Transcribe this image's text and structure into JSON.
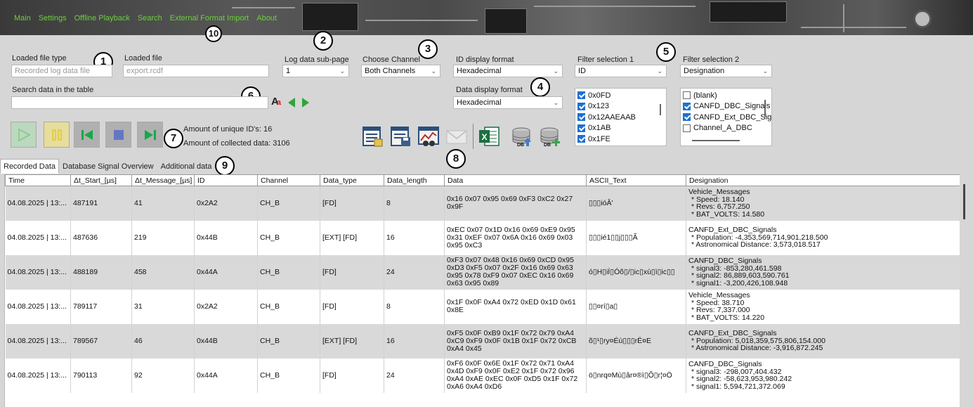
{
  "menu": [
    "Main",
    "Settings",
    "Offline Playback",
    "Search",
    "External Format Import",
    "About"
  ],
  "callouts": [
    "1",
    "2",
    "3",
    "4",
    "5",
    "6",
    "7",
    "8",
    "9",
    "10"
  ],
  "loaded_file_type": {
    "label": "Loaded file type",
    "placeholder": "Recorded log data file"
  },
  "loaded_file": {
    "label": "Loaded file",
    "placeholder": "export.rcdf"
  },
  "log_subpage": {
    "label": "Log data sub-page",
    "value": "1"
  },
  "channel": {
    "label": "Choose Channel",
    "value": "Both Channels"
  },
  "id_format": {
    "label": "ID display format",
    "value": "Hexadecimal"
  },
  "data_format": {
    "label": "Data display format",
    "value": "Hexadecimal"
  },
  "filter1": {
    "label": "Filter selection 1",
    "value": "ID",
    "items": [
      "0x0FD",
      "0x123",
      "0x12AAEAAB",
      "0x1AB",
      "0x1FE"
    ]
  },
  "filter2": {
    "label": "Filter selection 2",
    "value": "Designation",
    "items": [
      {
        "text": "(blank)",
        "checked": false
      },
      {
        "text": "CANFD_DBC_Signals",
        "checked": true
      },
      {
        "text": "CANFD_Ext_DBC_Sig",
        "checked": true
      },
      {
        "text": "Channel_A_DBC",
        "checked": false
      }
    ]
  },
  "search": {
    "label": "Search data in the table",
    "value": ""
  },
  "stats": {
    "unique_ids": "Amount of unique ID's: 16",
    "collected": "Amount of collected data: 3106"
  },
  "colors": {
    "menu": "#6ccf3c",
    "checkbox": "#1f6fd1",
    "row_alt": "#d9d9d9"
  },
  "tabs": [
    "Recorded Data",
    "Database Signal Overview",
    "Additional data"
  ],
  "table": {
    "columns": [
      "Time",
      "Δt_Start_[µs]",
      "Δt_Message_[µs]",
      "ID",
      "Channel",
      "Data_type",
      "Data_length",
      "Data",
      "ASCII_Text",
      "Designation"
    ],
    "rows": [
      {
        "time": "04.08.2025 | 13:...",
        "dt_start": "487191",
        "dt_msg": "41",
        "id": "0x2A2",
        "channel": "CH_B",
        "dtype": "[FD]",
        "dlen": "8",
        "data": "0x16 0x07 0x95 0x69 0xF3 0xC2 0x27 0x9F",
        "ascii": "▯▯▯ióÂ'",
        "desig": "Vehicle_Messages",
        "signals": [
          "* Speed: 18.140",
          "* Revs: 6,757.250",
          "* BAT_VOLTS: 14.580"
        ]
      },
      {
        "time": "04.08.2025 | 13:...",
        "dt_start": "487636",
        "dt_msg": "219",
        "id": "0x44B",
        "channel": "CH_B",
        "dtype": "[EXT] [FD]",
        "dlen": "16",
        "data": "0xEC 0x07 0x1D 0x16 0x69 0xE9 0x95 0x31 0xEF 0x07 0x6A 0x16 0x69 0x03 0x95 0xC3",
        "ascii": "▯▯▯ié1▯▯j▯▯▯Ã",
        "desig": "CANFD_Ext_DBC_Signals",
        "signals": [
          "* Population: -4,353,569,714,901,218.500",
          "* Astronomical Distance: 3,573,018.517"
        ]
      },
      {
        "time": "04.08.2025 | 13:...",
        "dt_start": "488189",
        "dt_msg": "458",
        "id": "0x44A",
        "channel": "CH_B",
        "dtype": "[FD]",
        "dlen": "24",
        "data": "0xF3 0x07 0x48 0x16 0x69 0xCD 0x95 0xD3 0xF5 0x07 0x2F 0x16 0x69 0x63 0x95 0x78 0xF9 0x07 0xEC 0x16 0x69 0x63 0x95 0x89",
        "ascii": "ó▯H▯iÍ▯Óõ▯/▯ic▯xù▯ì▯ic▯▯",
        "desig": "CANFD_DBC_Signals",
        "signals": [
          "* signal3: -853,280,461.598",
          "* signal2: 86,889,603,590.761",
          "* signal1: -3,200,426,108.948"
        ]
      },
      {
        "time": "04.08.2025 | 13:...",
        "dt_start": "789117",
        "dt_msg": "31",
        "id": "0x2A2",
        "channel": "CH_B",
        "dtype": "[FD]",
        "dlen": "8",
        "data": "0x1F 0x0F 0xA4 0x72 0xED 0x1D 0x61 0x8E",
        "ascii": "▯▯¤rí▯a▯",
        "desig": "Vehicle_Messages",
        "signals": [
          "* Speed: 38.710",
          "* Revs: 7,337.000",
          "* BAT_VOLTS: 14.220"
        ]
      },
      {
        "time": "04.08.2025 | 13:...",
        "dt_start": "789567",
        "dt_msg": "46",
        "id": "0x44B",
        "channel": "CH_B",
        "dtype": "[EXT] [FD]",
        "dlen": "16",
        "data": "0xF5 0x0F 0xB9 0x1F 0x72 0x79 0xA4 0xC9 0xF9 0x0F 0x1B 0x1F 0x72 0xCB 0xA4 0x45",
        "ascii": "õ▯¹▯ry¤Éù▯▯▯rË¤E",
        "desig": "CANFD_Ext_DBC_Signals",
        "signals": [
          "* Population: 5,018,359,575,806,154.000",
          "* Astronomical Distance: -3,916,872.245"
        ]
      },
      {
        "time": "04.08.2025 | 13:...",
        "dt_start": "790113",
        "dt_msg": "92",
        "id": "0x44A",
        "channel": "CH_B",
        "dtype": "[FD]",
        "dlen": "24",
        "data": "0xF6 0x0F 0x6E 0x1F 0x72 0x71 0xA4 0x4D 0xF9 0x0F 0xE2 0x1F 0x72 0x96 0xA4 0xAE 0xEC 0x0F 0xD5 0x1F 0x72 0xA6 0xA4 0xD6",
        "ascii": "ö▯nrq¤Mù▯âr¤®ì▯Õ▯r¦¤Ö",
        "desig": "CANFD_DBC_Signals",
        "signals": [
          "* signal3: -298,007,404.432",
          "* signal2: -58,623,953,980.242",
          "* signal1: 5,594,721,372.069"
        ]
      }
    ]
  }
}
